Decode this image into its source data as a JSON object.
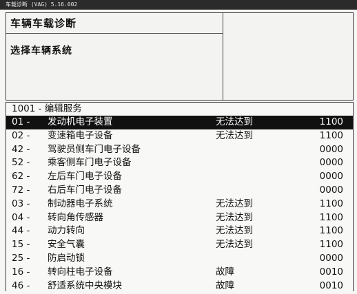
{
  "window": {
    "title": "车载诊断 (VAG) 5.16.002"
  },
  "header": {
    "title": "车辆车载诊断",
    "subtitle": "选择车辆系统"
  },
  "list": {
    "title": "1001 - 编辑服务",
    "rows": [
      {
        "code": "01 -",
        "name": "发动机电子装置",
        "status": "无法达到",
        "value": "1100"
      },
      {
        "code": "02 -",
        "name": "变速箱电子设备",
        "status": "无法达到",
        "value": "1100"
      },
      {
        "code": "42 -",
        "name": "驾驶员侧车门电子设备",
        "status": "",
        "value": "0000"
      },
      {
        "code": "52 -",
        "name": "乘客侧车门电子设备",
        "status": "",
        "value": "0000"
      },
      {
        "code": "62 -",
        "name": "左后车门电子设备",
        "status": "",
        "value": "0000"
      },
      {
        "code": "72 -",
        "name": "右后车门电子设备",
        "status": "",
        "value": "0000"
      },
      {
        "code": "03 -",
        "name": "制动器电子系统",
        "status": "无法达到",
        "value": "1100"
      },
      {
        "code": "04 -",
        "name": "转向角传感器",
        "status": "无法达到",
        "value": "1100"
      },
      {
        "code": "44 -",
        "name": "动力转向",
        "status": "无法达到",
        "value": "1100"
      },
      {
        "code": "15 -",
        "name": "安全气囊",
        "status": "无法达到",
        "value": "1100"
      },
      {
        "code": "25 -",
        "name": "防启动锁",
        "status": "",
        "value": "0000"
      },
      {
        "code": "16 -",
        "name": "转向柱电子设备",
        "status": "故障",
        "value": "0010"
      },
      {
        "code": "46 -",
        "name": "舒适系统中央模块",
        "status": "故障",
        "value": "0010"
      }
    ]
  }
}
